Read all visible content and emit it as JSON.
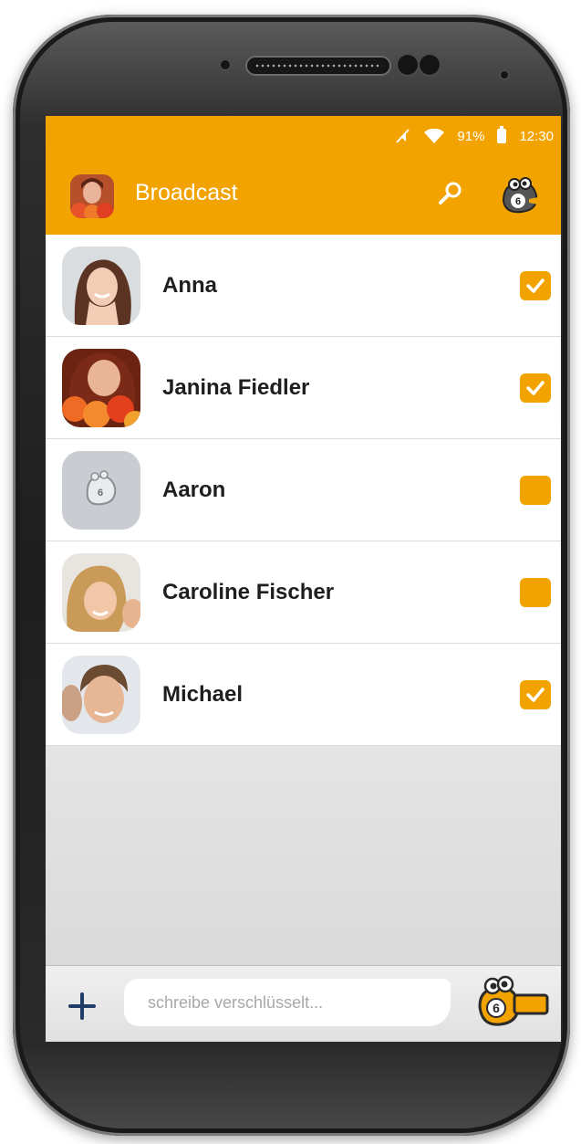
{
  "status_bar": {
    "battery": "91%",
    "time": "12:30"
  },
  "app_bar": {
    "title": "Broadcast"
  },
  "contacts": [
    {
      "name": "Anna",
      "selected": true
    },
    {
      "name": "Janina Fiedler",
      "selected": true
    },
    {
      "name": "Aaron",
      "selected": false
    },
    {
      "name": "Caroline Fischer",
      "selected": false
    },
    {
      "name": "Michael",
      "selected": true
    }
  ],
  "composer": {
    "placeholder": "schreibe verschlüsselt..."
  },
  "icons": [
    "mute-icon",
    "wifi-icon",
    "battery-icon",
    "search-icon",
    "mascot-icon",
    "plus-icon",
    "send-icon",
    "checkmark-icon"
  ],
  "colors": {
    "accent": "#f2a300",
    "row_bg": "#ffffff",
    "name_text": "#1e1e1e"
  }
}
